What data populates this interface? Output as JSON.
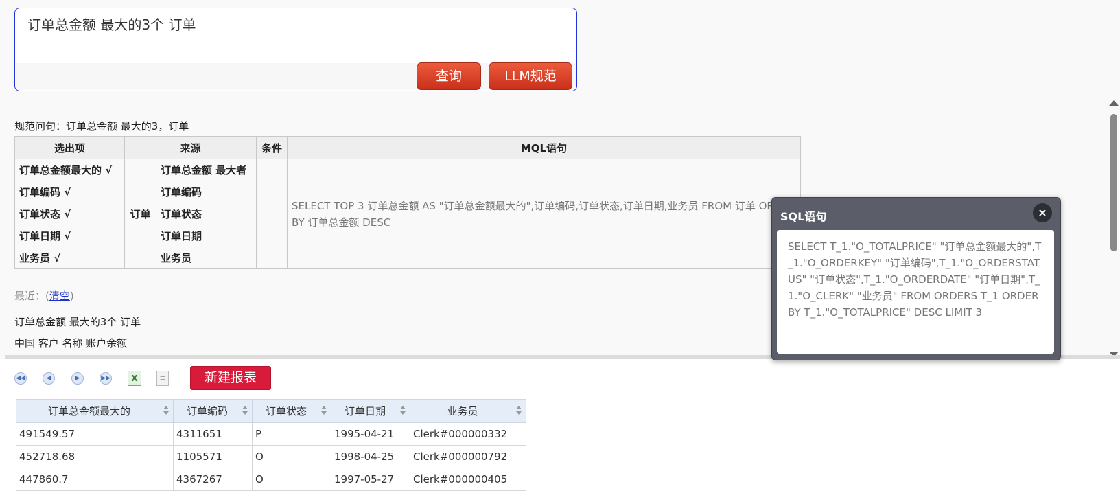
{
  "query": {
    "text": "订单总金额 最大的3个 订单",
    "search_button": "查询",
    "llm_button": "LLM规范"
  },
  "normalized": "规范问句：订单总金额 最大的3，订单",
  "mql_table": {
    "headers": [
      "选出项",
      "来源",
      "条件",
      "MQL语句"
    ],
    "select_items": [
      "订单总金额最大的 √",
      "订单编码 √",
      "订单状态 √",
      "订单日期 √",
      "业务员 √"
    ],
    "source_entity": "订单",
    "source_fields": [
      "订单总金额 最大者",
      "订单编码",
      "订单状态",
      "订单日期",
      "业务员"
    ],
    "mql": "SELECT TOP 3 订单总金额 AS \"订单总金额最大的\",订单编码,订单状态,订单日期,业务员 FROM 订单 ORDER BY 订单总金额 DESC"
  },
  "recent": {
    "label": "最近：(",
    "clear_link": "清空",
    "close_paren": ")",
    "items": [
      "订单总金额 最大的3个 订单",
      "中国 客户 名称 账户余额"
    ]
  },
  "popup": {
    "title": "SQL语句",
    "close": "×",
    "sql": "SELECT T_1.\"O_TOTALPRICE\" \"订单总金额最大的\",T_1.\"O_ORDERKEY\" \"订单编码\",T_1.\"O_ORDERSTATUS\" \"订单状态\",T_1.\"O_ORDERDATE\" \"订单日期\",T_1.\"O_CLERK\" \"业务员\" FROM ORDERS T_1 ORDER BY T_1.\"O_TOTALPRICE\" DESC LIMIT 3"
  },
  "toolbar": {
    "new_report": "新建报表",
    "icons": [
      "first-page-icon",
      "prev-page-icon",
      "next-page-icon",
      "last-page-icon",
      "excel-export-icon",
      "document-icon"
    ]
  },
  "results": {
    "columns": [
      "订单总金额最大的",
      "订单编码",
      "订单状态",
      "订单日期",
      "业务员"
    ],
    "rows": [
      [
        "491549.57",
        "4311651",
        "P",
        "1995-04-21",
        "Clerk#000000332"
      ],
      [
        "452718.68",
        "1105571",
        "O",
        "1998-04-25",
        "Clerk#000000792"
      ],
      [
        "447860.7",
        "4367267",
        "O",
        "1997-05-27",
        "Clerk#000000405"
      ]
    ]
  },
  "colors": {
    "accent_red": "#d81b3a",
    "query_button": "#dc4428",
    "popup_bg": "#5b5e69",
    "grid_header": "#e5eef8"
  }
}
